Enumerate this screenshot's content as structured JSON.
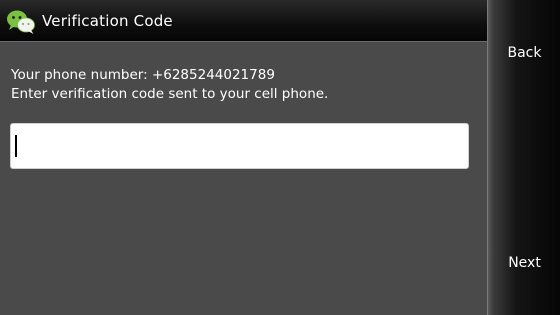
{
  "window": {
    "title": "Verification Code",
    "icon": "wechat-chat-bubbles-icon",
    "accent_color": "#7ac143"
  },
  "main": {
    "phone_line": "Your phone number: +6285244021789",
    "instruction": "Enter verification code sent to your cell phone.",
    "code_input": {
      "value": "",
      "placeholder": ""
    }
  },
  "softkeys": {
    "back_label": "Back",
    "next_label": "Next"
  }
}
